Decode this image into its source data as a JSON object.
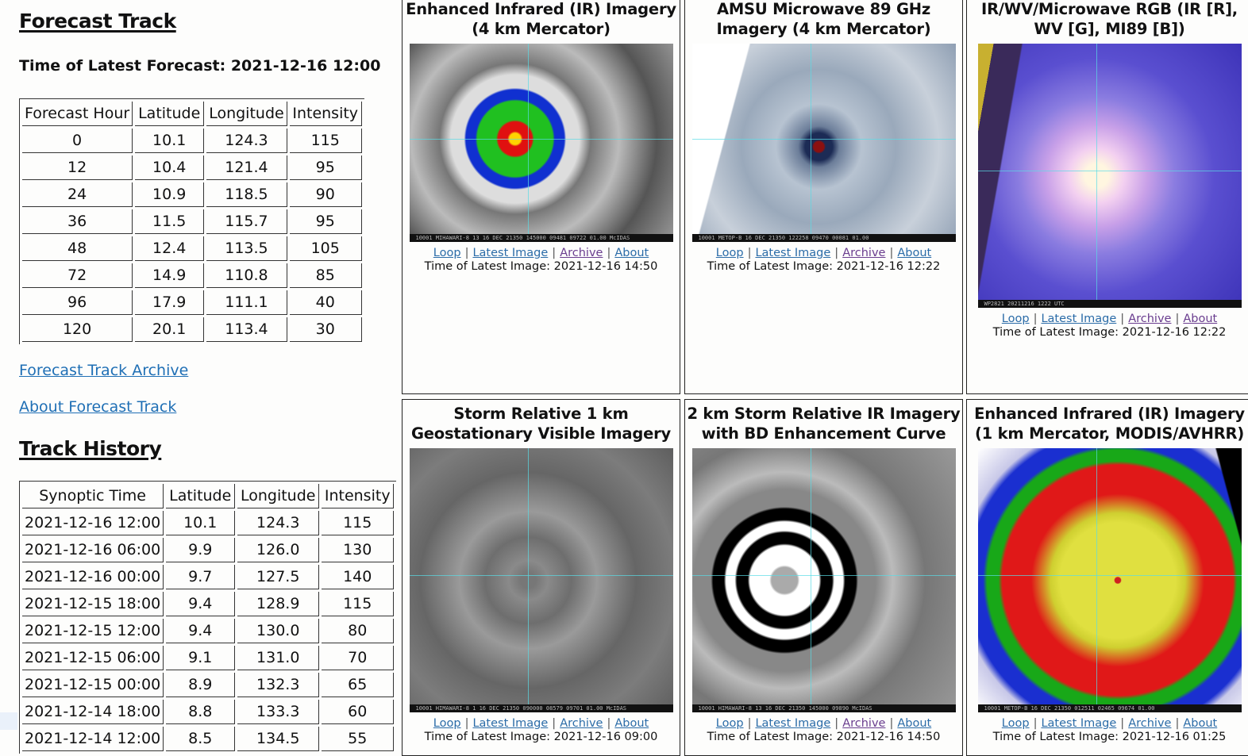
{
  "forecast": {
    "heading": "Forecast Track",
    "latest_label": "Time of Latest Forecast: 2021-12-16 12:00",
    "columns": [
      "Forecast Hour",
      "Latitude",
      "Longitude",
      "Intensity"
    ],
    "rows": [
      [
        "0",
        "10.1",
        "124.3",
        "115"
      ],
      [
        "12",
        "10.4",
        "121.4",
        "95"
      ],
      [
        "24",
        "10.9",
        "118.5",
        "90"
      ],
      [
        "36",
        "11.5",
        "115.7",
        "95"
      ],
      [
        "48",
        "12.4",
        "113.5",
        "105"
      ],
      [
        "72",
        "14.9",
        "110.8",
        "85"
      ],
      [
        "96",
        "17.9",
        "111.1",
        "40"
      ],
      [
        "120",
        "20.1",
        "113.4",
        "30"
      ]
    ],
    "archive_link": "Forecast Track Archive",
    "about_link": "About Forecast Track"
  },
  "history": {
    "heading": "Track History",
    "columns": [
      "Synoptic Time",
      "Latitude",
      "Longitude",
      "Intensity"
    ],
    "rows": [
      [
        "2021-12-16 12:00",
        "10.1",
        "124.3",
        "115"
      ],
      [
        "2021-12-16 06:00",
        "9.9",
        "126.0",
        "130"
      ],
      [
        "2021-12-16 00:00",
        "9.7",
        "127.5",
        "140"
      ],
      [
        "2021-12-15 18:00",
        "9.4",
        "128.9",
        "115"
      ],
      [
        "2021-12-15 12:00",
        "9.4",
        "130.0",
        "80"
      ],
      [
        "2021-12-15 06:00",
        "9.1",
        "131.0",
        "70"
      ],
      [
        "2021-12-15 00:00",
        "8.9",
        "132.3",
        "65"
      ],
      [
        "2021-12-14 18:00",
        "8.8",
        "133.3",
        "60"
      ],
      [
        "2021-12-14 12:00",
        "8.5",
        "134.5",
        "55"
      ]
    ]
  },
  "link_labels": {
    "loop": "Loop",
    "latest": "Latest Image",
    "archive": "Archive",
    "about": "About",
    "separator": "|"
  },
  "link_colors": {
    "unvisited": "#2b6ca8",
    "visited": "#6a3d8f"
  },
  "panels": [
    {
      "title": "Enhanced Infrared (IR) Imagery (4 km Mercator)",
      "time": "Time of Latest Image: 2021-12-16 14:50",
      "image_caption": "10001 MIHAWARI-8 13 16 DEC 21350 145000 09481 09722 01.00 McIDAS",
      "image_kind": "enhanced-ir",
      "visited": [
        "archive"
      ]
    },
    {
      "title": "AMSU Microwave 89 GHz Imagery (4 km Mercator)",
      "time": "Time of Latest Image: 2021-12-16 12:22",
      "image_caption": "10001 METOP-B 16 DEC 21350 122258 09470 00081 01.00",
      "image_kind": "microwave",
      "visited": [
        "archive"
      ]
    },
    {
      "title": "IR/WV/Microwave RGB (IR [R], WV [G], MI89 [B])",
      "time": "Time of Latest Image: 2021-12-16 12:22",
      "image_caption": "WP2821 20211216 1222 UTC",
      "image_kind": "rgb",
      "visited": [
        "archive",
        "about"
      ]
    },
    {
      "title": "Storm Relative 1 km Geostationary Visible Imagery",
      "time": "Time of Latest Image: 2021-12-16 09:00",
      "image_caption": "10001 HIMAWARI-8 1 16 DEC 21350 090000 08579 09701 01.00 McIDAS",
      "image_kind": "visible",
      "visited": []
    },
    {
      "title": "2 km Storm Relative IR Imagery with BD Enhancement Curve",
      "time": "Time of Latest Image: 2021-12-16 14:50",
      "image_caption": "10001 HIMAWARI-8 13 16 DEC 21350 145000 09890 McIDAS",
      "image_kind": "bd-curve",
      "visited": [
        "archive"
      ]
    },
    {
      "title": "Enhanced Infrared (IR) Imagery (1 km Mercator, MODIS/AVHRR)",
      "time": "Time of Latest Image: 2021-12-16 01:25",
      "image_caption": "10001 METOP-B 16 DEC 21350 012511 02465 09674 01.00",
      "image_kind": "modis-ir",
      "visited": []
    }
  ]
}
